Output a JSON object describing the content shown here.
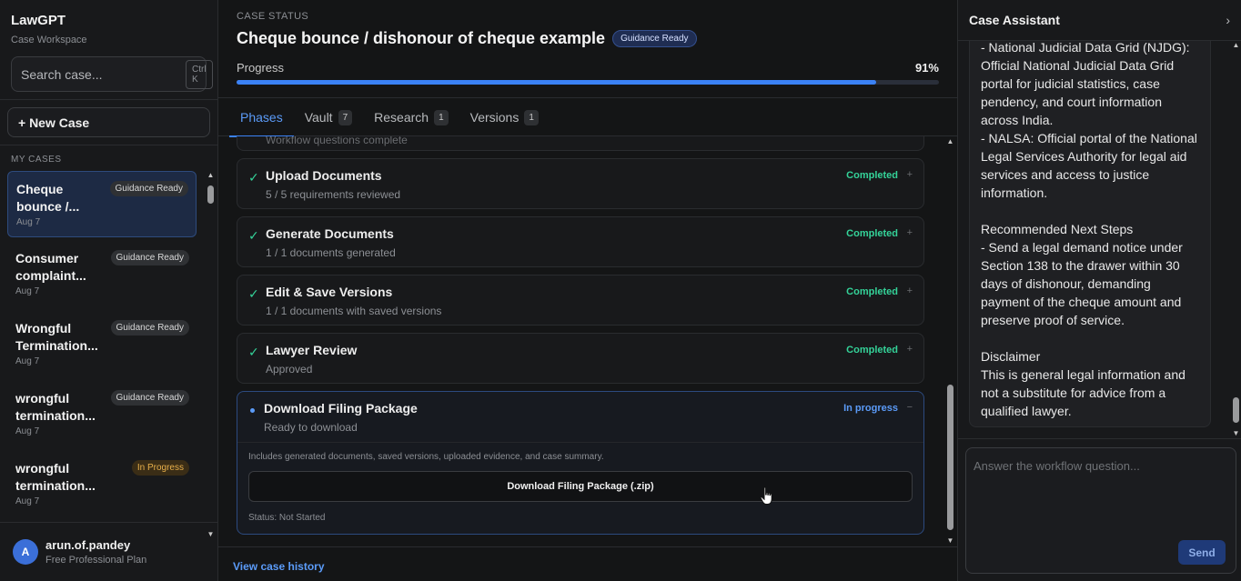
{
  "sidebar": {
    "brand_title": "LawGPT",
    "brand_sub": "Case Workspace",
    "search_placeholder": "Search case...",
    "search_shortcut": "Ctrl K",
    "new_case_label": "+ New Case",
    "section_label": "MY CASES",
    "cases": [
      {
        "name": "Cheque bounce /...",
        "date": "Aug 7",
        "badge": "Guidance Ready"
      },
      {
        "name": "Consumer complaint...",
        "date": "Aug 7",
        "badge": "Guidance Ready"
      },
      {
        "name": "Wrongful Termination...",
        "date": "Aug 7",
        "badge": "Guidance Ready"
      },
      {
        "name": "wrongful termination...",
        "date": "Aug 7",
        "badge": "Guidance Ready"
      },
      {
        "name": "wrongful termination...",
        "date": "Aug 7",
        "badge": "In Progress"
      }
    ],
    "user": {
      "initial": "A",
      "name": "arun.of.pandey",
      "plan": "Free Professional Plan"
    }
  },
  "main": {
    "eyebrow": "CASE STATUS",
    "title": "Cheque bounce / dishonour of cheque example",
    "title_badge": "Guidance Ready",
    "progress_label": "Progress",
    "progress_value": "91%",
    "progress_fraction": 0.91,
    "tabs": [
      {
        "label": "Phases",
        "count": ""
      },
      {
        "label": "Vault",
        "count": "7"
      },
      {
        "label": "Research",
        "count": "1"
      },
      {
        "label": "Versions",
        "count": "1"
      }
    ],
    "phase_top_sub": "Workflow questions complete",
    "phases": [
      {
        "title": "Upload Documents",
        "sub": "5 / 5 requirements reviewed",
        "status": "Completed",
        "toggle": "+"
      },
      {
        "title": "Generate Documents",
        "sub": "1 / 1 documents generated",
        "status": "Completed",
        "toggle": "+"
      },
      {
        "title": "Edit & Save Versions",
        "sub": "1 / 1 documents with saved versions",
        "status": "Completed",
        "toggle": "+"
      },
      {
        "title": "Lawyer Review",
        "sub": "Approved",
        "status": "Completed",
        "toggle": "+"
      }
    ],
    "current_phase": {
      "title": "Download Filing Package",
      "sub": "Ready to download",
      "status": "In progress",
      "toggle": "−",
      "description": "Includes generated documents, saved versions, uploaded evidence, and case summary.",
      "button_label": "Download Filing Package (.zip)",
      "status_text": "Status: Not Started"
    },
    "history_link": "View case history"
  },
  "assistant": {
    "title": "Case Assistant",
    "lines": [
      "- National Judicial Data Grid (NJDG):",
      "Official National Judicial Data Grid",
      "portal for judicial statistics, case",
      "pendency, and court information",
      "across India.",
      "- NALSA: Official portal of the National",
      "Legal Services Authority for legal aid",
      "services and access to justice",
      "information.",
      "",
      "Recommended Next Steps",
      "- Send a legal demand notice under",
      "Section 138 to the drawer within 30",
      "days of dishonour, demanding",
      "payment of the cheque amount and",
      "preserve proof of service.",
      "",
      "Disclaimer",
      "This is general legal information and",
      "not a substitute for advice from a",
      "qualified lawyer."
    ],
    "input_placeholder": "Answer the workflow question...",
    "send_label": "Send"
  },
  "colors": {
    "accent": "#3b82f6",
    "success": "#34d399",
    "warning": "#e8b04b"
  }
}
